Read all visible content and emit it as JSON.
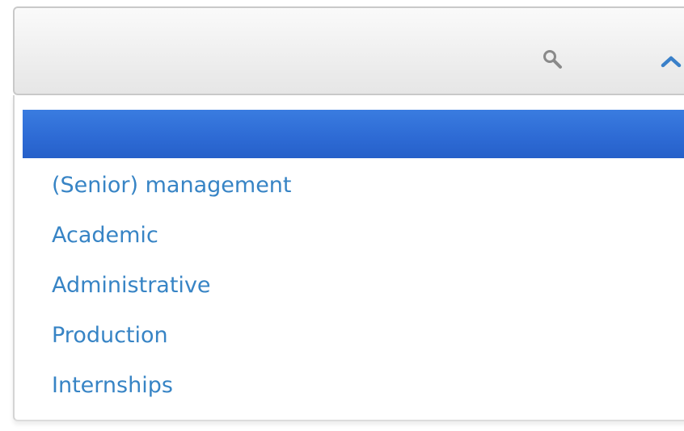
{
  "select": {
    "search_icon": "search-icon",
    "toggle_icon": "chevron-up-icon",
    "highlighted_option": ""
  },
  "options": [
    "(Senior) management",
    "Academic",
    "Administrative",
    "Production",
    "Internships"
  ],
  "colors": {
    "highlight": "#2d6ad4",
    "option_text": "#3784c5",
    "chevron": "#3a80c9",
    "search_icon": "#8a8a8a"
  }
}
